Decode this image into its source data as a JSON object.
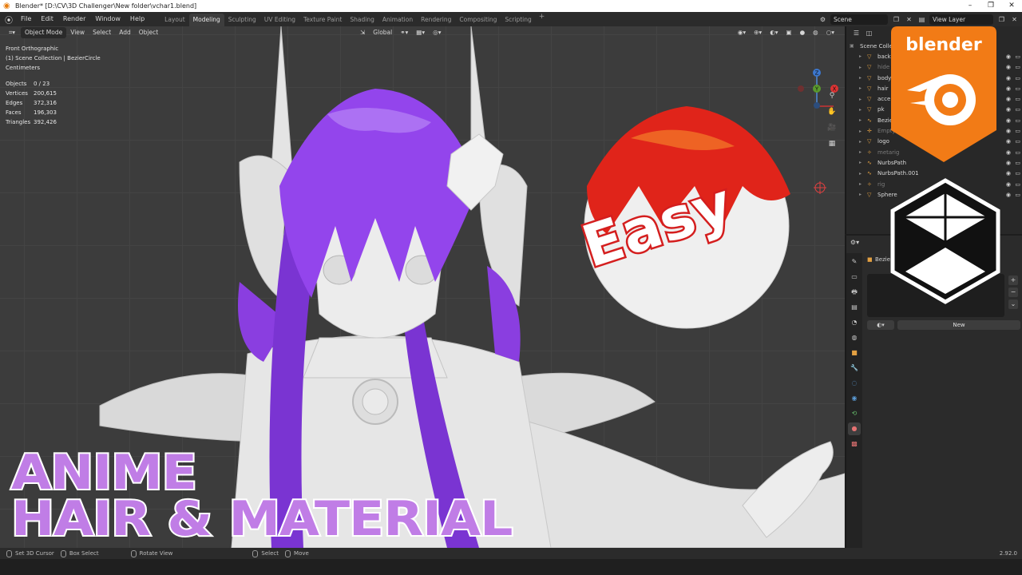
{
  "window": {
    "title": "Blender* [D:\\CV\\3D Challenger\\New folder\\vchar1.blend]",
    "minimize": "–",
    "maximize": "❐",
    "close": "✕"
  },
  "menu": [
    "File",
    "Edit",
    "Render",
    "Window",
    "Help"
  ],
  "workspaces": [
    "Layout",
    "Modeling",
    "Sculpting",
    "UV Editing",
    "Texture Paint",
    "Shading",
    "Animation",
    "Rendering",
    "Compositing",
    "Scripting"
  ],
  "active_workspace": "Modeling",
  "scene_field": "Scene",
  "view_layer_field": "View Layer",
  "viewport": {
    "mode": "Object Mode",
    "menus": [
      "View",
      "Select",
      "Add",
      "Object"
    ],
    "orientation": "Global",
    "info": [
      "Front Orthographic",
      "(1) Scene Collection | BezierCircle",
      "Centimeters"
    ],
    "stats": [
      {
        "k": "Objects",
        "v": "0 / 23"
      },
      {
        "k": "Vertices",
        "v": "200,615"
      },
      {
        "k": "Edges",
        "v": "372,316"
      },
      {
        "k": "Faces",
        "v": "196,303"
      },
      {
        "k": "Triangles",
        "v": "392,426"
      }
    ],
    "gizmo": {
      "z": "Z",
      "y": "Y",
      "x": "X"
    }
  },
  "overlay": {
    "easy": "Easy",
    "line1": "ANIME",
    "line2": "HAIR & MATERIAL",
    "blender_logo_text": "blender"
  },
  "outliner": {
    "root": "Scene Collection",
    "items": [
      {
        "name": "back",
        "icon": "mesh-icon",
        "dim": false
      },
      {
        "name": "hide",
        "icon": "mesh-icon",
        "dim": true
      },
      {
        "name": "body",
        "icon": "mesh-icon",
        "dim": false
      },
      {
        "name": "hair",
        "icon": "mesh-icon",
        "dim": false
      },
      {
        "name": "acce",
        "icon": "mesh-icon",
        "dim": false
      },
      {
        "name": "pk",
        "icon": "mesh-icon",
        "dim": false
      },
      {
        "name": "Bezie",
        "icon": "curve-icon",
        "dim": false
      },
      {
        "name": "Empty",
        "icon": "empty-icon",
        "dim": true
      },
      {
        "name": "logo",
        "icon": "mesh-icon",
        "dim": false
      },
      {
        "name": "metarig",
        "icon": "armature-icon",
        "dim": true
      },
      {
        "name": "NurbsPath",
        "icon": "curve-icon",
        "dim": false
      },
      {
        "name": "NurbsPath.001",
        "icon": "curve-icon",
        "dim": false
      },
      {
        "name": "rig",
        "icon": "armature-icon",
        "dim": true
      },
      {
        "name": "Sphere",
        "icon": "mesh-icon",
        "dim": false
      }
    ]
  },
  "properties": {
    "object_name": "Bezier C",
    "new_label": "New"
  },
  "statusbar": {
    "items": [
      "Set 3D Cursor",
      "Box Select",
      "Rotate View",
      "Select",
      "Move"
    ],
    "version": "2.92.0"
  }
}
